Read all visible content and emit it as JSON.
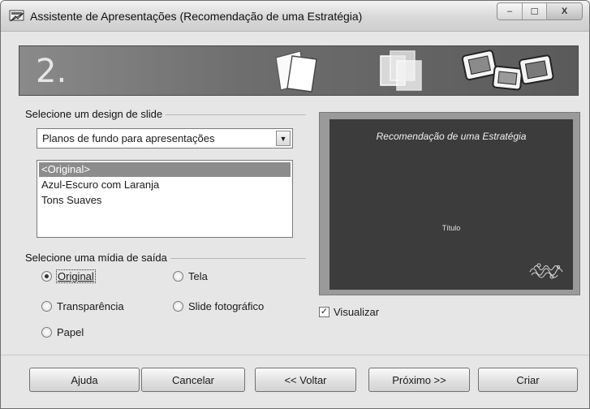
{
  "window": {
    "title": "Assistente de Apresentações (Recomendação de uma Estratégia)",
    "controls": {
      "minimize": "‒",
      "maximize": "☐",
      "close": "X"
    }
  },
  "banner": {
    "step": "2."
  },
  "design_group": {
    "label": "Selecione um design de slide",
    "dropdown_value": "Planos de fundo para apresentações",
    "items": [
      "<Original>",
      "Azul-Escuro com Laranja",
      "Tons Suaves"
    ],
    "selected_index": 0
  },
  "output_group": {
    "label": "Selecione uma mídia de saída",
    "options": [
      {
        "label": "Original",
        "checked": true
      },
      {
        "label": "Tela",
        "checked": false
      },
      {
        "label": "Transparência",
        "checked": false
      },
      {
        "label": "Slide fotográfico",
        "checked": false
      },
      {
        "label": "Papel",
        "checked": false
      }
    ]
  },
  "preview": {
    "title": "Recomendação de uma Estratégia",
    "subtitle": "Título"
  },
  "visualizar": {
    "label": "Visualizar",
    "checked": true
  },
  "buttons": {
    "help": "Ajuda",
    "cancel": "Cancelar",
    "back": "<< Voltar",
    "next": "Próximo >>",
    "create": "Criar"
  },
  "colors": {
    "selection": "#8c8c8c",
    "preview_bg": "#3c3c3c"
  }
}
